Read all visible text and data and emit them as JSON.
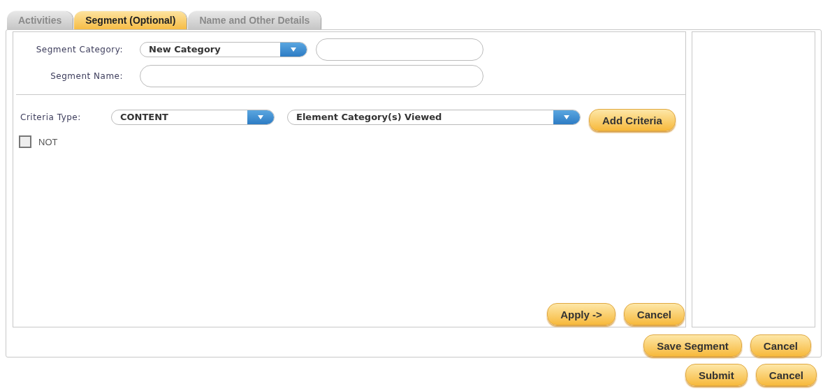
{
  "tabs": [
    {
      "label": "Activities",
      "selected": false
    },
    {
      "label": "Segment (Optional)",
      "selected": true
    },
    {
      "label": "Name and Other Details",
      "selected": false
    }
  ],
  "segment_category": {
    "label": "Segment Category:",
    "dropdown": "New Category"
  },
  "segment_name": {
    "label": "Segment Name:"
  },
  "criteria": {
    "label": "Criteria Type:",
    "type_dropdown": "CONTENT",
    "criteria_dropdown": "Element Category(s) Viewed",
    "add_button": "Add Criteria"
  },
  "not_checkbox": {
    "label": "NOT",
    "checked": false
  },
  "panel_buttons": [
    "Apply ->",
    "Cancel"
  ],
  "segment_buttons": [
    "Save Segment",
    "Cancel"
  ],
  "page_buttons": [
    "Submit",
    "Cancel"
  ]
}
